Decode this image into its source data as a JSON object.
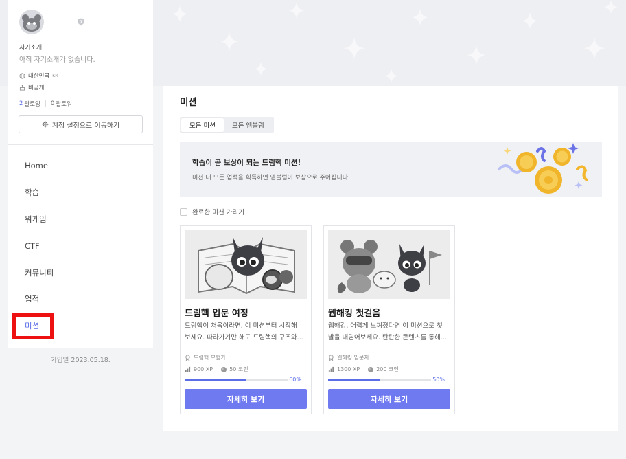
{
  "profile": {
    "bio_label": "자기소개",
    "bio_text": "아직 자기소개가 없습니다.",
    "country": "대한민국",
    "country_code": "KR",
    "birthday": "비공개",
    "following_count": "2",
    "following_label": "팔로잉",
    "followers_count": "0",
    "followers_label": "팔로워",
    "settings_button": "계정 설정으로 이동하기",
    "joined": "가입일 2023.05.18."
  },
  "nav": {
    "items": [
      {
        "label": "Home"
      },
      {
        "label": "학습"
      },
      {
        "label": "워게임"
      },
      {
        "label": "CTF"
      },
      {
        "label": "커뮤니티"
      },
      {
        "label": "업적"
      },
      {
        "label": "미션"
      }
    ],
    "active_index": 6
  },
  "main": {
    "title": "미션",
    "tabs": [
      {
        "label": "모든 미션"
      },
      {
        "label": "모든 엠블럼"
      }
    ],
    "banner": {
      "title": "학습이 곧 보상이 되는 드림핵 미션!",
      "subtitle": "미션 내 모든 업적을 획득하면 엠블럼이 보상으로 주어집니다."
    },
    "hide_completed_label": "완료한 미션 가리기",
    "cards": [
      {
        "title": "드림핵 입문 여정",
        "desc_line1": "드림핵이 처음이라면, 이 미션부터 시작해",
        "desc_line2": "보세요. 따라가기만 해도 드림핵의 구조와...",
        "reward_title": "드림핵 모험가",
        "xp": "900 XP",
        "coins": "50 코인",
        "progress": 0.6,
        "progress_label": "60%",
        "button": "자세히 보기"
      },
      {
        "title": "웹해킹 첫걸음",
        "desc_line1": "웹해킹, 어렵게 느껴졌다면 이 미션으로 첫",
        "desc_line2": "발을 내딛어보세요. 탄탄한 콘텐츠를 통해...",
        "reward_title": "웹해킹 입문자",
        "xp": "1300 XP",
        "coins": "200 코인",
        "progress": 0.5,
        "progress_label": "50%",
        "button": "자세히 보기"
      }
    ]
  },
  "colors": {
    "accent": "#5b6ee8",
    "button": "#6f79f0",
    "highlight_box": "#ee1111"
  }
}
